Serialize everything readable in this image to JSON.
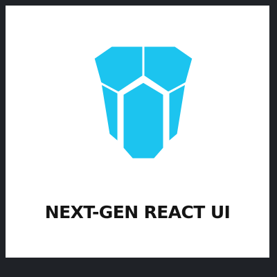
{
  "brand": {
    "logo_icon": "robot-mask-logo-icon",
    "logo_color": "#1cc4ef",
    "logo_outline_color": "#ffffff",
    "name": "NEXT-GEN REACT UI"
  },
  "colors": {
    "background": "#1f2227",
    "card": "#ffffff",
    "text": "#141414"
  }
}
